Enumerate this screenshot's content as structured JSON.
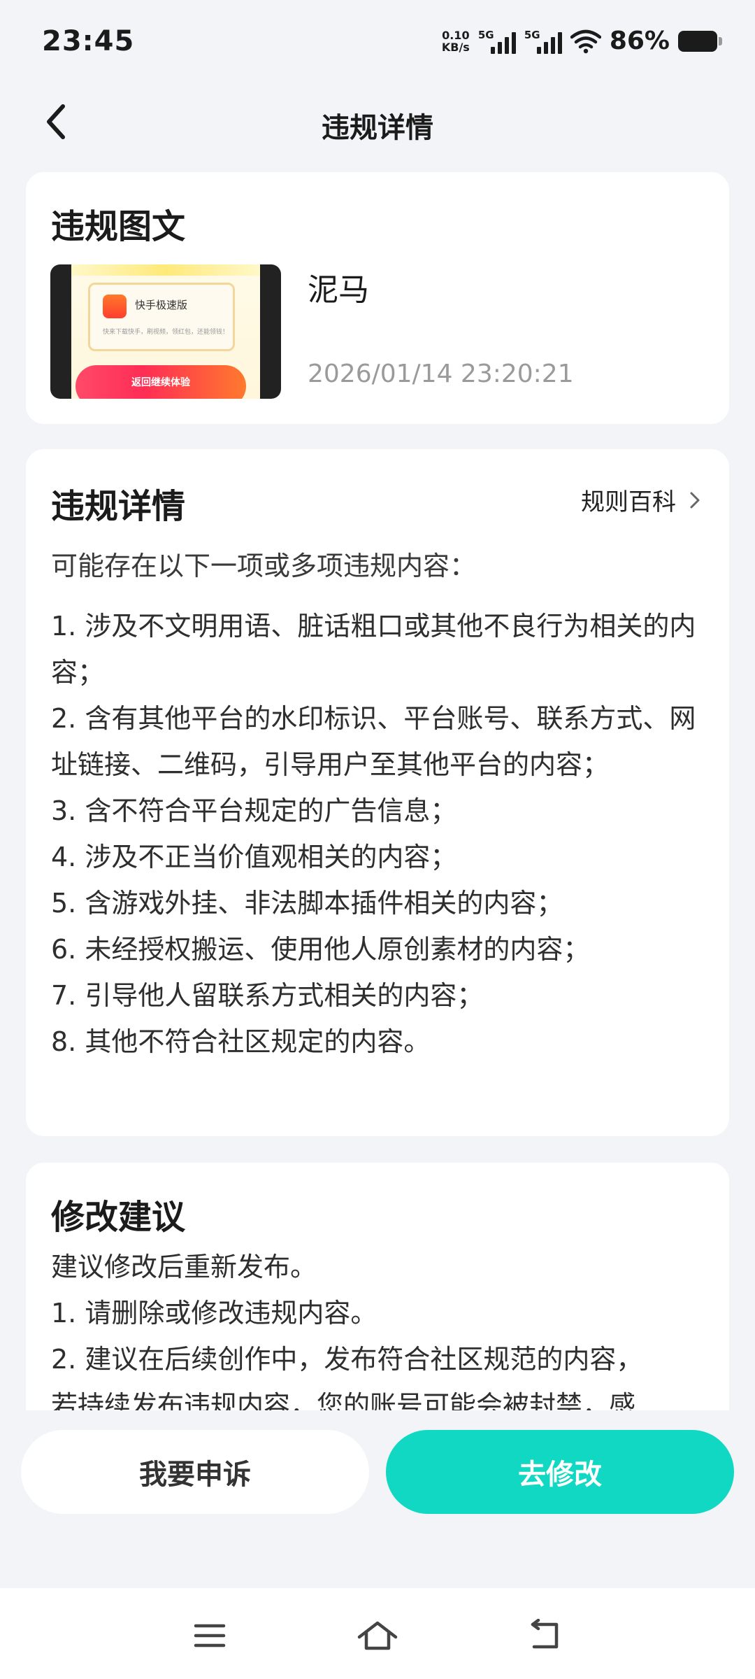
{
  "status_bar": {
    "time": "23:45",
    "net_speed_value": "0.10",
    "net_speed_unit": "KB/s",
    "signal_1_label": "5G",
    "signal_2_label": "5G",
    "battery_percent": "86%",
    "icons": [
      "wifi-icon",
      "battery-icon",
      "signal-icon"
    ]
  },
  "nav": {
    "title": "违规详情"
  },
  "post": {
    "section_title": "违规图文",
    "username": "泥马",
    "timestamp": "2026/01/14 23:20:21",
    "thumbnail": {
      "app_name": "快手极速版",
      "description": "快来下载快手，刷视频，领红包，还能领钱！",
      "button_label": "返回继续体验"
    }
  },
  "details": {
    "section_title": "违规详情",
    "rules_link_label": "规则百科",
    "intro": "可能存在以下一项或多项违规内容：",
    "items": [
      "1. 涉及不文明用语、脏话粗口或其他不良行为相关的内容；",
      "2. 含有其他平台的水印标识、平台账号、联系方式、网址链接、二维码，引导用户至其他平台的内容；",
      "3. 含不符合平台规定的广告信息；",
      "4. 涉及不正当价值观相关的内容；",
      "5. 含游戏外挂、非法脚本插件相关的内容；",
      "6. 未经授权搬运、使用他人原创素材的内容；",
      "7. 引导他人留联系方式相关的内容；",
      "8. 其他不符合社区规定的内容。"
    ]
  },
  "suggestions": {
    "section_title": "修改建议",
    "lines": [
      "建议修改后重新发布。",
      "1. 请删除或修改违规内容。",
      "2. 建议在后续创作中，发布符合社区规范的内容，",
      "若持续发布违规内容，您的账号可能会被封禁，感"
    ]
  },
  "actions": {
    "appeal_label": "我要申诉",
    "edit_label": "去修改"
  },
  "colors": {
    "accent": "#10d8c3",
    "background": "#f3f4f7",
    "card": "#ffffff"
  }
}
